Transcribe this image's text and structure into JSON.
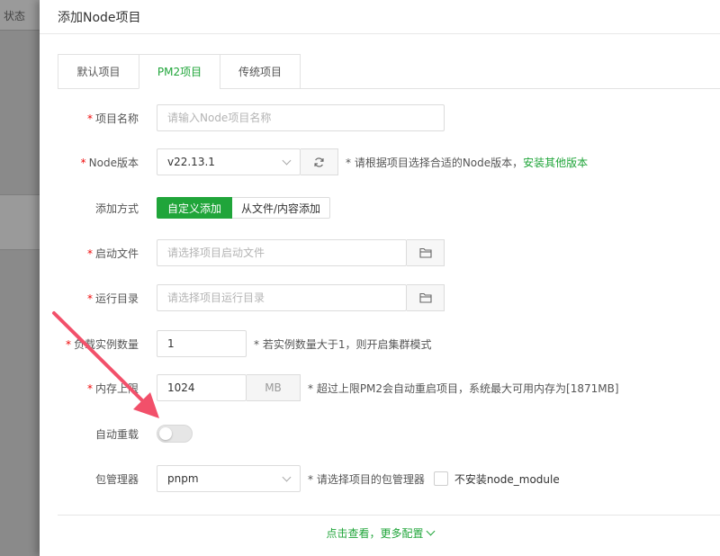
{
  "background": {
    "status_label": "状态"
  },
  "modal": {
    "title": "添加Node项目"
  },
  "tabs": [
    {
      "label": "默认项目",
      "active": false
    },
    {
      "label": "PM2项目",
      "active": true
    },
    {
      "label": "传统项目",
      "active": false
    }
  ],
  "form": {
    "project_name": {
      "label": "项目名称",
      "placeholder": "请输入Node项目名称"
    },
    "node_version": {
      "label": "Node版本",
      "value": "v22.13.1",
      "hint": "* 请根据项目选择合适的Node版本，",
      "link": "安装其他版本"
    },
    "add_method": {
      "label": "添加方式",
      "option_custom": "自定义添加",
      "option_file": "从文件/内容添加"
    },
    "start_file": {
      "label": "启动文件",
      "placeholder": "请选择项目启动文件"
    },
    "run_dir": {
      "label": "运行目录",
      "placeholder": "请选择项目运行目录"
    },
    "instances": {
      "label": "负载实例数量",
      "value": "1",
      "hint": "* 若实例数量大于1，则开启集群模式"
    },
    "memory_limit": {
      "label": "内存上限",
      "value": "1024",
      "unit": "MB",
      "hint": "* 超过上限PM2会自动重启项目，系统最大可用内存为[1871MB]"
    },
    "auto_reload": {
      "label": "自动重载",
      "enabled": false
    },
    "package_manager": {
      "label": "包管理器",
      "value": "pnpm",
      "hint": "* 请选择项目的包管理器",
      "checkbox_label": "不安装node_module"
    }
  },
  "more": {
    "label": "点击查看，更多配置"
  },
  "colors": {
    "accent": "#20a53a",
    "required": "#ef0808",
    "arrow": "#f2506a"
  }
}
